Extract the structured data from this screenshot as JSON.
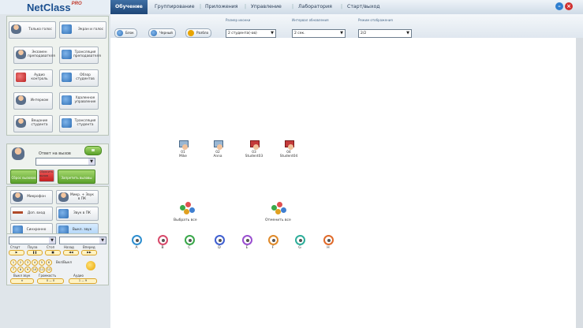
{
  "app": {
    "logo": "NetClass",
    "logo_sup": "PRO"
  },
  "menu": [
    "Обучение",
    "Группирование",
    "Приложения",
    "Управление",
    "Лаборатория",
    "Старт/выход"
  ],
  "toolbar": {
    "buttons": [
      "Блок",
      "Черный",
      "Разбло"
    ],
    "size_label": "Размер иконки",
    "size_value": "2 студента(-ов)",
    "interval_label": "Интервал обновления",
    "interval_value": "2 сек.",
    "mode_label": "Режим отображения",
    "mode_value": "2/2"
  },
  "sidebar": {
    "top": [
      "Только голос",
      "Экран и голос"
    ],
    "grid": [
      [
        "Экзамен преподавателя",
        "Трансляция преподавателя"
      ],
      [
        "Аудио контроль",
        "Обзор студентов"
      ],
      [
        "Интерком",
        "Удаленное управление"
      ],
      [
        "Вещание студента",
        "Трансляция студента"
      ]
    ],
    "answer_label": "Ответ на вызов",
    "answer_buttons": [
      "Сброс вызовов",
      "Сбросить вызов",
      "Запретить вызовы"
    ],
    "bottom": [
      [
        "Микрофон",
        "Микр. + Звук в ПК"
      ],
      [
        "Доп. вход",
        "Звук в ПК"
      ],
      [
        "Синхронно",
        "Выкл. звук"
      ]
    ],
    "media_labels": [
      "Старт",
      "Пауза",
      "Стоп",
      "Назад",
      "Вперед"
    ],
    "media_glyphs": [
      "▶",
      "❚❚",
      "■",
      "◀◀",
      "▶▶"
    ],
    "number_pad": [
      "1",
      "2",
      "3",
      "4",
      "5",
      "6",
      "7",
      "8",
      "9",
      "10",
      "11",
      "12"
    ],
    "volume_label": "Вкл/Выкл",
    "bottom_labels": [
      "Выкл звук",
      "Громкость",
      "Аудио"
    ],
    "bottom_values": [
      "✕",
      "0 — 0",
      "1 — 9"
    ]
  },
  "students": [
    {
      "id": "01",
      "name": "Mike",
      "online": true
    },
    {
      "id": "02",
      "name": "Anna",
      "online": true
    },
    {
      "id": "03",
      "name": "Student03",
      "online": false
    },
    {
      "id": "04",
      "name": "Student04",
      "online": false
    }
  ],
  "groups": {
    "select_all": "Выбрать все",
    "deselect_all": "Отменить все"
  },
  "teams": [
    {
      "name": "A",
      "color": "#2f8fd0"
    },
    {
      "name": "B",
      "color": "#d84a6b"
    },
    {
      "name": "C",
      "color": "#3aa84a"
    },
    {
      "name": "D",
      "color": "#3f5fd0"
    },
    {
      "name": "E",
      "color": "#9a4fd0"
    },
    {
      "name": "F",
      "color": "#e08a2a"
    },
    {
      "name": "G",
      "color": "#2fae9a"
    },
    {
      "name": "H",
      "color": "#e06a2a"
    }
  ]
}
